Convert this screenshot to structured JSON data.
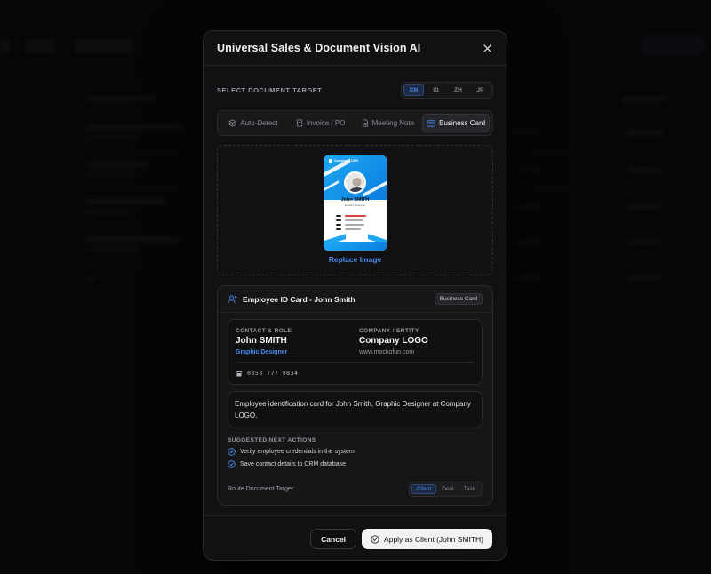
{
  "modal": {
    "title": "Universal Sales & Document Vision AI",
    "close_icon": "close-icon"
  },
  "target_section": {
    "label": "SELECT DOCUMENT TARGET",
    "languages": [
      {
        "code": "EN",
        "active": true
      },
      {
        "code": "ID",
        "active": false
      },
      {
        "code": "ZH",
        "active": false
      },
      {
        "code": "JP",
        "active": false
      }
    ]
  },
  "doc_tabs": [
    {
      "label": "Auto-Detect",
      "icon": "layers-icon",
      "active": false
    },
    {
      "label": "Invoice / PO",
      "icon": "document-icon",
      "active": false
    },
    {
      "label": "Meeting Note",
      "icon": "note-icon",
      "active": false
    },
    {
      "label": "Business Card",
      "icon": "card-icon",
      "active": true
    }
  ],
  "dropzone": {
    "replace_label": "Replace Image",
    "card_preview": {
      "name": "John SMITH",
      "role": "Graphic Designer"
    }
  },
  "result": {
    "title": "Employee ID Card - John Smith",
    "badge": "Business Card",
    "contact": {
      "label": "CONTACT & ROLE",
      "name": "John SMITH",
      "role": "Graphic Designer",
      "phone": "0853 777 9834"
    },
    "company": {
      "label": "COMPANY / ENTITY",
      "name": "Company LOGO",
      "website": "www.mockofun.com"
    },
    "description": "Employee identification card for John Smith, Graphic Designer at Company LOGO.",
    "actions_label": "SUGGESTED NEXT ACTIONS",
    "actions": [
      "Verify employee credentials in the system",
      "Save contact details to CRM database"
    ],
    "route_label": "Route Document Target:",
    "route_options": [
      {
        "label": "Client",
        "active": true
      },
      {
        "label": "Deal",
        "active": false
      },
      {
        "label": "Task",
        "active": false
      }
    ]
  },
  "footer": {
    "cancel_label": "Cancel",
    "apply_label": "Apply as Client (John SMITH)"
  },
  "colors": {
    "accent": "#4a8cf0",
    "modal_bg": "#111113",
    "page_bg": "#0b0b0c"
  }
}
